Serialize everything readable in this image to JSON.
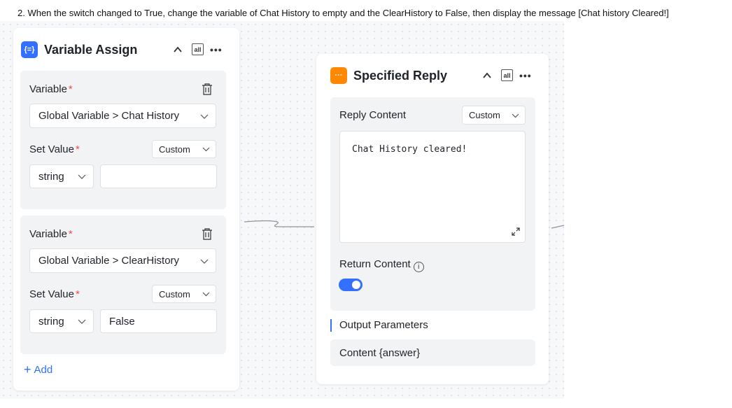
{
  "instruction": "2.   When the switch changed to True, change the variable of Chat History to empty and the ClearHistory to False, then display the message [Chat history Cleared!]",
  "variable_assign": {
    "title": "Variable Assign",
    "icon": "variable-braces-icon",
    "icon_text": "{=}",
    "all_label": "all",
    "more_label": "•••",
    "assignments": [
      {
        "variable_label": "Variable",
        "required_mark": "*",
        "variable_value": "Global Variable > Chat History",
        "set_value_label": "Set Value",
        "set_value_mode": "Custom",
        "type": "string",
        "value": ""
      },
      {
        "variable_label": "Variable",
        "required_mark": "*",
        "variable_value": "Global Variable > ClearHistory",
        "set_value_label": "Set Value",
        "set_value_mode": "Custom",
        "type": "string",
        "value": "False"
      }
    ],
    "add_label": "Add"
  },
  "specified_reply": {
    "title": "Specified Reply",
    "icon": "chat-bubble-icon",
    "icon_text": "···",
    "all_label": "all",
    "more_label": "•••",
    "reply_content_label": "Reply Content",
    "reply_mode": "Custom",
    "reply_text": "Chat History cleared!",
    "return_content_label": "Return Content",
    "info_glyph": "i",
    "return_content_enabled": true,
    "output_parameters_label": "Output Parameters",
    "output_content": "Content {answer}"
  },
  "colors": {
    "accent": "#3370ff",
    "reply_icon": "#ff8800",
    "required": "#f54a45",
    "section_bg": "#f2f3f5"
  }
}
